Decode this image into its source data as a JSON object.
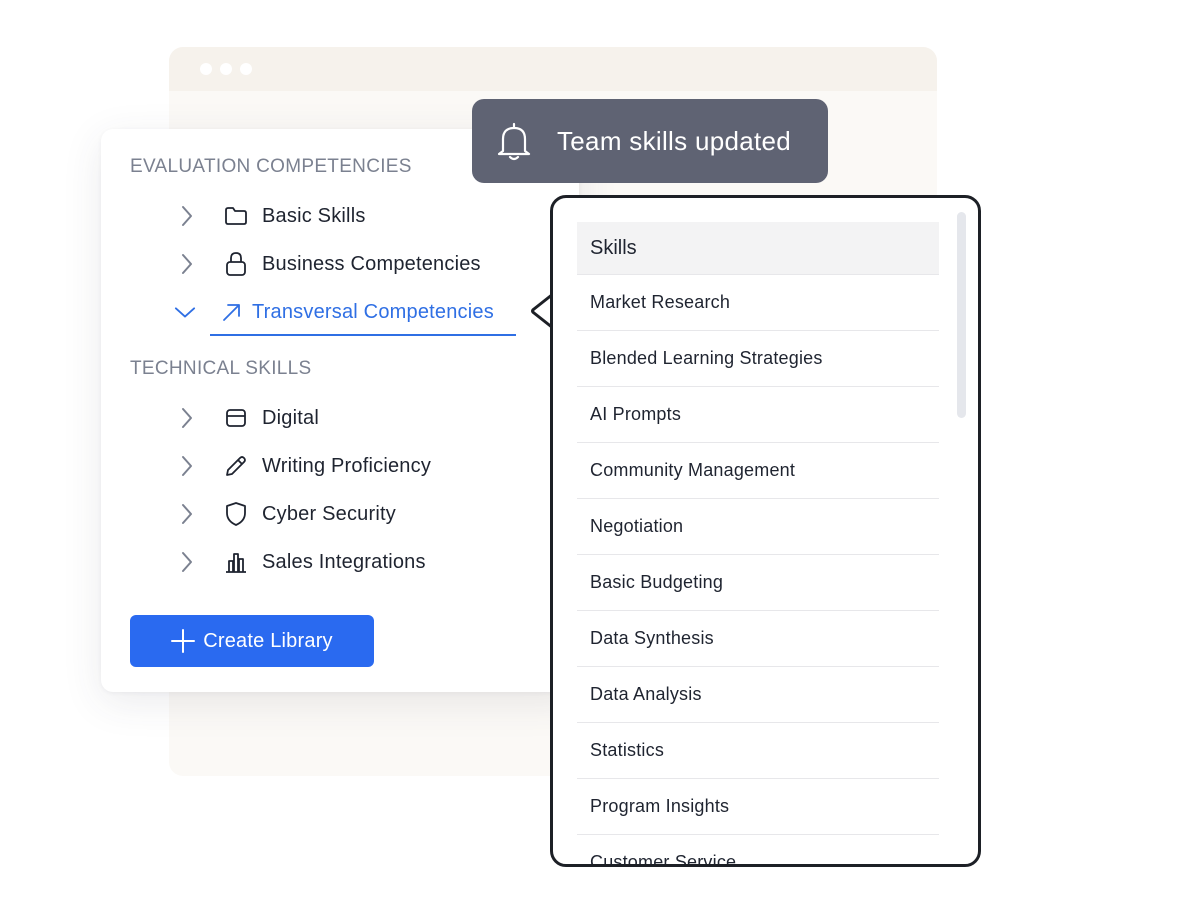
{
  "toast": {
    "message": "Team skills updated",
    "icon": "bell-icon"
  },
  "library": {
    "sections": [
      {
        "title": "EVALUATION COMPETENCIES",
        "items": [
          {
            "label": "Basic Skills",
            "icon": "folder-icon",
            "expanded": false
          },
          {
            "label": "Business Competencies",
            "icon": "lock-icon",
            "expanded": false
          },
          {
            "label": "Transversal Competencies",
            "icon": "arrow-up-right-icon",
            "expanded": true
          }
        ]
      },
      {
        "title": "TECHNICAL SKILLS",
        "items": [
          {
            "label": "Digital",
            "icon": "card-icon",
            "expanded": false
          },
          {
            "label": "Writing Proficiency",
            "icon": "pencil-icon",
            "expanded": false
          },
          {
            "label": "Cyber Security",
            "icon": "shield-icon",
            "expanded": false
          },
          {
            "label": "Sales Integrations",
            "icon": "bar-chart-icon",
            "expanded": false
          }
        ]
      }
    ],
    "create_button_label": "Create Library"
  },
  "skills": {
    "header": "Skills",
    "items": [
      "Market Research",
      "Blended Learning Strategies",
      "AI Prompts",
      "Community Management",
      "Negotiation",
      "Basic Budgeting",
      "Data Synthesis",
      "Data Analysis",
      "Statistics",
      "Program Insights",
      "Customer Service"
    ]
  },
  "colors": {
    "accent": "#2a6af0",
    "active_text": "#2f6fe4",
    "toast_bg": "#5f6373",
    "section_title": "#7b8190"
  }
}
